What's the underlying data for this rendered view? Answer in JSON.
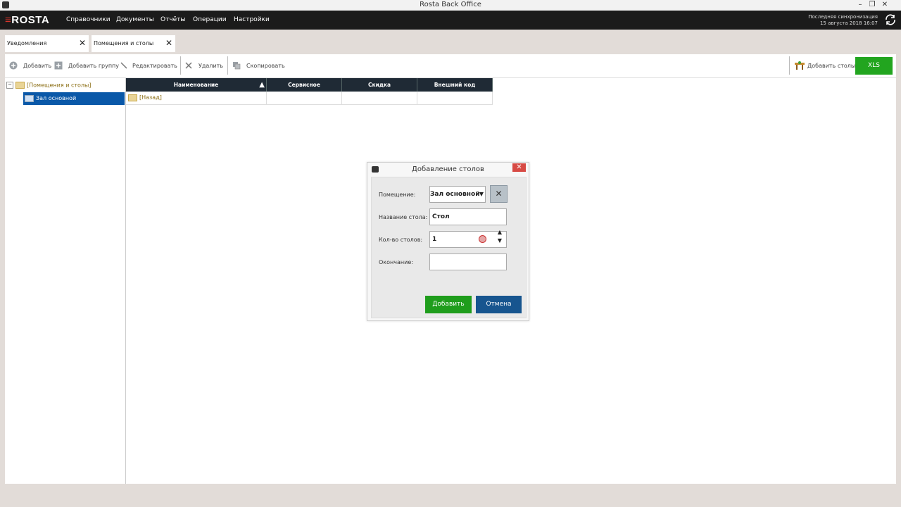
{
  "window": {
    "title": "Rosta Back Office"
  },
  "menubar": {
    "logo": "ROSTA",
    "items": [
      "Справочники",
      "Документы",
      "Отчёты",
      "Операции",
      "Настройки"
    ],
    "sync_label": "Последняя синхронизация",
    "sync_time": "15 августа 2018 16:07"
  },
  "tabs": [
    {
      "label": "Уведомления"
    },
    {
      "label": "Помещения и столы"
    }
  ],
  "toolbar": {
    "add": "Добавить",
    "add_group": "Добавить группу",
    "edit": "Редактировать",
    "delete": "Удалить",
    "copy": "Скопировать",
    "add_tables": "Добавить столы",
    "xls": "XLS"
  },
  "tree": {
    "root": "[Помещения и столы]",
    "child": "Зал основной"
  },
  "grid": {
    "columns": [
      "Наименование",
      "Сервисное обслуживание",
      "Скидка",
      "Внешний код"
    ],
    "back_row": "[Назад]"
  },
  "dialog": {
    "title": "Добавление столов",
    "room_label": "Помещение:",
    "room_value": "Зал основной",
    "name_label": "Название стола:",
    "name_value": "Стол",
    "count_label": "Кол-во столов:",
    "count_value": "1",
    "ending_label": "Окончание:",
    "ending_value": "",
    "add_button": "Добавить",
    "cancel_button": "Отмена"
  }
}
